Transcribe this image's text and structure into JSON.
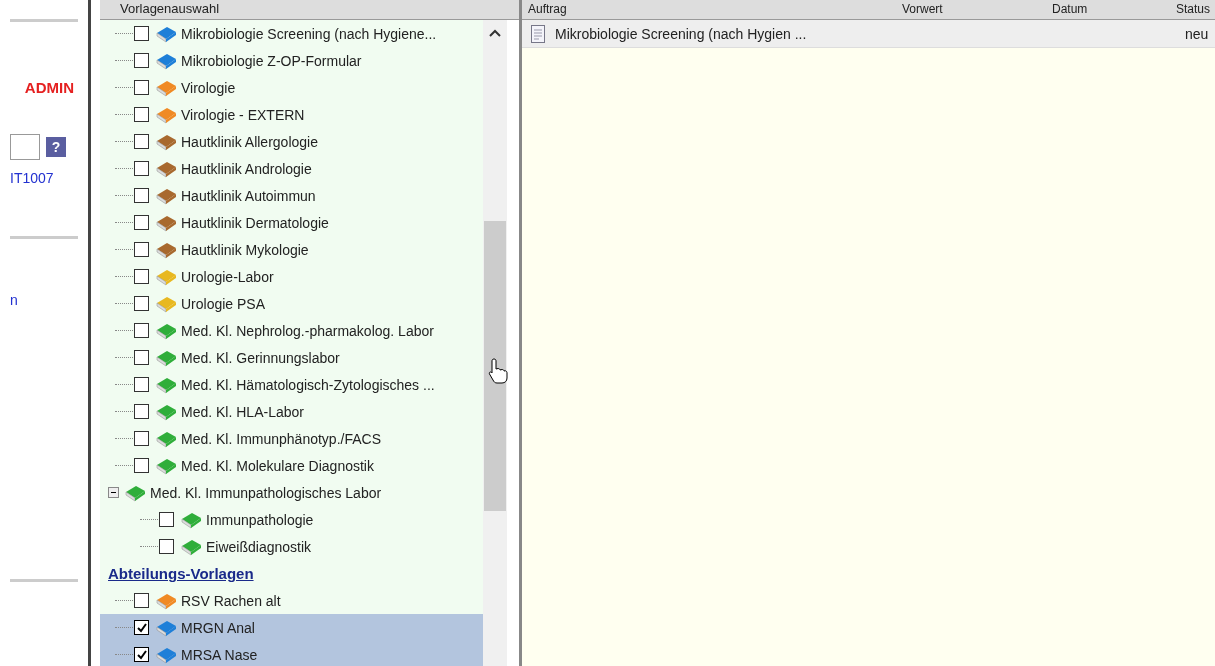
{
  "left_panel": {
    "user_role": "ADMIN",
    "help_button": "?",
    "user_link": "IT1007",
    "cut_link": "n"
  },
  "template_tree": {
    "header": "Vorlagenauswahl",
    "nodes": [
      {
        "kind": "item",
        "label": "Mikrobiologie Screening (nach Hygiene...",
        "color": "#1e7fd8",
        "checked": false,
        "selected": false
      },
      {
        "kind": "item",
        "label": "Mikrobiologie Z-OP-Formular",
        "color": "#1e7fd8",
        "checked": false,
        "selected": false
      },
      {
        "kind": "item",
        "label": "Virologie",
        "color": "#f08a24",
        "checked": false,
        "selected": false
      },
      {
        "kind": "item",
        "label": "Virologie - EXTERN",
        "color": "#f08a24",
        "checked": false,
        "selected": false
      },
      {
        "kind": "item",
        "label": "Hautklinik Allergologie",
        "color": "#a8692e",
        "checked": false,
        "selected": false
      },
      {
        "kind": "item",
        "label": "Hautklinik Andrologie",
        "color": "#a8692e",
        "checked": false,
        "selected": false
      },
      {
        "kind": "item",
        "label": "Hautklinik Autoimmun",
        "color": "#a8692e",
        "checked": false,
        "selected": false
      },
      {
        "kind": "item",
        "label": "Hautklinik Dermatologie",
        "color": "#a8692e",
        "checked": false,
        "selected": false
      },
      {
        "kind": "item",
        "label": "Hautklinik Mykologie",
        "color": "#a8692e",
        "checked": false,
        "selected": false
      },
      {
        "kind": "item",
        "label": "Urologie-Labor",
        "color": "#e8b820",
        "checked": false,
        "selected": false
      },
      {
        "kind": "item",
        "label": "Urologie PSA",
        "color": "#e8b820",
        "checked": false,
        "selected": false
      },
      {
        "kind": "item",
        "label": "Med. Kl. Nephrolog.-pharmakolog. Labor",
        "color": "#2fae3a",
        "checked": false,
        "selected": false
      },
      {
        "kind": "item",
        "label": "Med. Kl. Gerinnungslabor",
        "color": "#2fae3a",
        "checked": false,
        "selected": false
      },
      {
        "kind": "item",
        "label": "Med. Kl. Hämatologisch-Zytologisches  ...",
        "color": "#2fae3a",
        "checked": false,
        "selected": false
      },
      {
        "kind": "item",
        "label": "Med. Kl. HLA-Labor",
        "color": "#2fae3a",
        "checked": false,
        "selected": false
      },
      {
        "kind": "item",
        "label": "Med. Kl. Immunphänotyp./FACS",
        "color": "#2fae3a",
        "checked": false,
        "selected": false
      },
      {
        "kind": "item",
        "label": "Med. Kl. Molekulare Diagnostik",
        "color": "#2fae3a",
        "checked": false,
        "selected": false
      },
      {
        "kind": "group",
        "label": "Med. Kl. Immunpathologisches Labor",
        "color": "#2fae3a",
        "expanded": true,
        "children": [
          {
            "label": "Immunpathologie",
            "color": "#2fae3a",
            "checked": false,
            "selected": false
          },
          {
            "label": "Eiweißdiagnostik",
            "color": "#2fae3a",
            "checked": false,
            "selected": false
          }
        ]
      },
      {
        "kind": "heading",
        "label": "Abteilungs-Vorlagen"
      },
      {
        "kind": "item",
        "label": "RSV Rachen alt",
        "color": "#f08a24",
        "checked": false,
        "selected": false
      },
      {
        "kind": "item",
        "label": "MRGN Anal",
        "color": "#1e7fd8",
        "checked": true,
        "selected": true
      },
      {
        "kind": "item",
        "label": "MRSA Nase",
        "color": "#1e7fd8",
        "checked": true,
        "selected": true
      }
    ]
  },
  "orders": {
    "columns": [
      "Auftrag",
      "Vorwert",
      "Datum",
      "Status"
    ],
    "rows": [
      {
        "order": "Mikrobiologie Screening (nach Hygien ...",
        "status": "neu"
      }
    ]
  }
}
